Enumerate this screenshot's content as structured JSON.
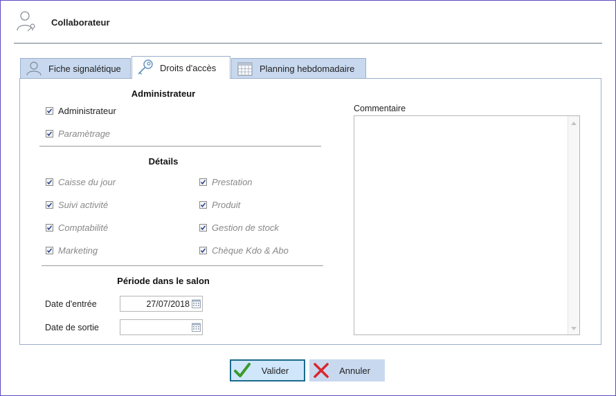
{
  "header": {
    "title": "Collaborateur",
    "icon": "user-key-icon"
  },
  "tabs": [
    {
      "label": "Fiche signalétique",
      "icon": "person-icon",
      "active": false
    },
    {
      "label": "Droits d'accès",
      "icon": "key-icon",
      "active": true
    },
    {
      "label": "Planning hebdomadaire",
      "icon": "calendar-icon",
      "active": false
    }
  ],
  "admin": {
    "title": "Administrateur",
    "items": [
      {
        "label": "Administrateur",
        "checked": true,
        "enabled": true
      },
      {
        "label": "Paramètrage",
        "checked": true,
        "enabled": false
      }
    ]
  },
  "details": {
    "title": "Détails",
    "left": [
      {
        "label": "Caisse du jour",
        "checked": true,
        "enabled": false
      },
      {
        "label": "Suivi activité",
        "checked": true,
        "enabled": false
      },
      {
        "label": "Comptabilité",
        "checked": true,
        "enabled": false
      },
      {
        "label": "Marketing",
        "checked": true,
        "enabled": false
      }
    ],
    "right": [
      {
        "label": "Prestation",
        "checked": true,
        "enabled": false
      },
      {
        "label": "Produit",
        "checked": true,
        "enabled": false
      },
      {
        "label": "Gestion de stock",
        "checked": true,
        "enabled": false
      },
      {
        "label": "Chèque Kdo & Abo",
        "checked": true,
        "enabled": false
      }
    ]
  },
  "period": {
    "title": "Période dans le salon",
    "entry_label": "Date d'entrée",
    "entry_value": "27/07/2018",
    "exit_label": "Date de sortie",
    "exit_value": ""
  },
  "comment": {
    "label": "Commentaire",
    "value": ""
  },
  "buttons": {
    "valider": "Valider",
    "annuler": "Annuler"
  },
  "colors": {
    "tab_bg": "#c8d9ef",
    "accent_border": "#1a6b8a",
    "check_green": "#3a9a2a",
    "cancel_red": "#d9262c"
  }
}
